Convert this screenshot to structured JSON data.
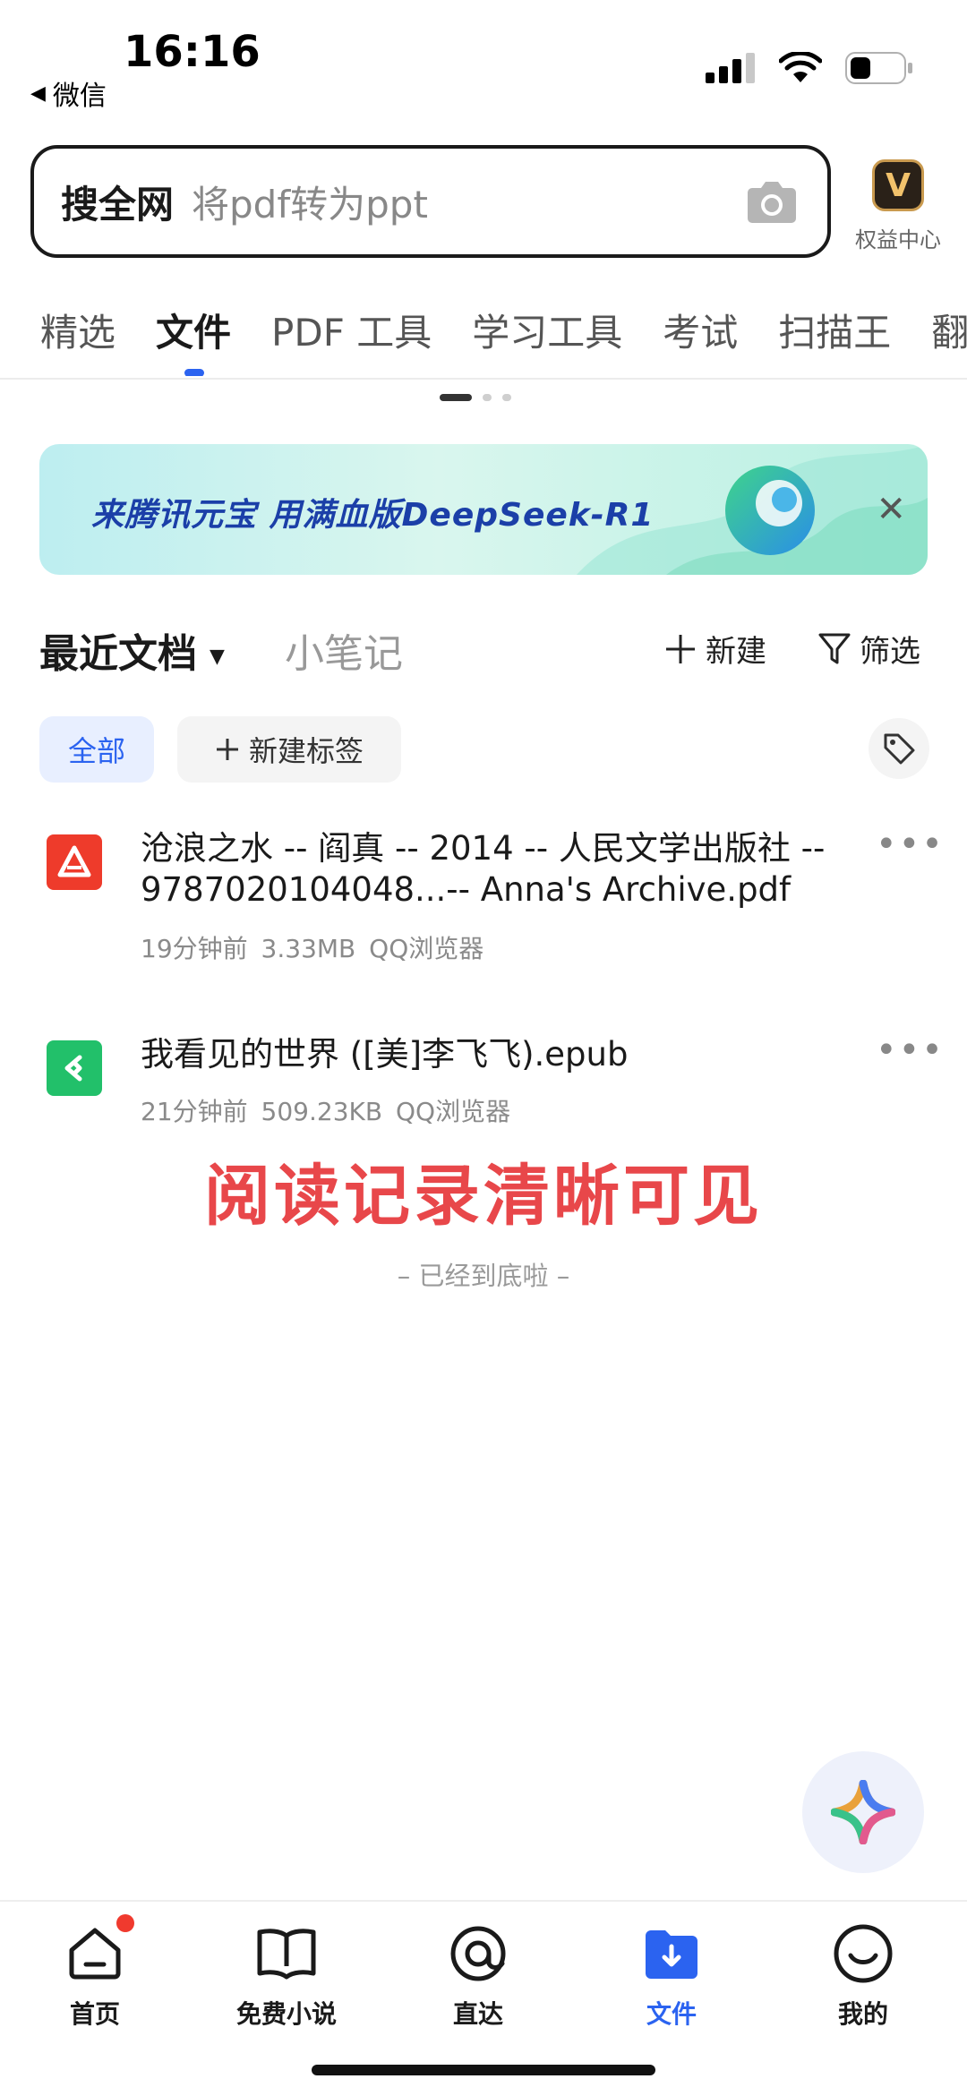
{
  "status_bar": {
    "time": "16:16",
    "back_app": "微信",
    "battery_level": 0.25
  },
  "search": {
    "scope": "搜全网",
    "placeholder": "将pdf转为ppt"
  },
  "rights_center": {
    "badge": "V",
    "label": "权益中心"
  },
  "tabs": [
    {
      "label": "精选",
      "active": false
    },
    {
      "label": "文件",
      "active": true
    },
    {
      "label": "PDF 工具",
      "active": false
    },
    {
      "label": "学习工具",
      "active": false
    },
    {
      "label": "考试",
      "active": false
    },
    {
      "label": "扫描王",
      "active": false
    },
    {
      "label": "翻",
      "active": false
    }
  ],
  "banner": {
    "text": "来腾讯元宝 用满血版DeepSeek-R1",
    "close": "✕"
  },
  "docs_header": {
    "recent": "最近文档",
    "notes": "小笔记",
    "new_label": "新建",
    "filter_label": "筛选"
  },
  "chips": {
    "all": "全部",
    "new_tag": "新建标签"
  },
  "files": [
    {
      "title": "沧浪之水 -- 阎真 -- 2014 -- 人民文学出版社 -- 9787020104048...-- Anna's Archive.pdf",
      "time": "19分钟前",
      "size": "3.33MB",
      "source": "QQ浏览器",
      "type": "pdf",
      "color": "#ee3b2b"
    },
    {
      "title": "我看见的世界 ([美]李飞飞).epub",
      "time": "21分钟前",
      "size": "509.23KB",
      "source": "QQ浏览器",
      "type": "epub",
      "color": "#22c06a"
    }
  ],
  "overlay_caption": "阅读记录清晰可见",
  "end_note": "–  已经到底啦  –",
  "bottom_nav": [
    {
      "label": "首页",
      "icon": "home-icon",
      "badge": true
    },
    {
      "label": "免费小说",
      "icon": "book-icon",
      "badge": false
    },
    {
      "label": "直达",
      "icon": "direct-icon",
      "badge": false
    },
    {
      "label": "文件",
      "icon": "file-download-icon",
      "active": true
    },
    {
      "label": "我的",
      "icon": "smile-icon",
      "badge": false
    }
  ],
  "colors": {
    "accent": "#2b63f0",
    "watermark": "#e8474a"
  }
}
